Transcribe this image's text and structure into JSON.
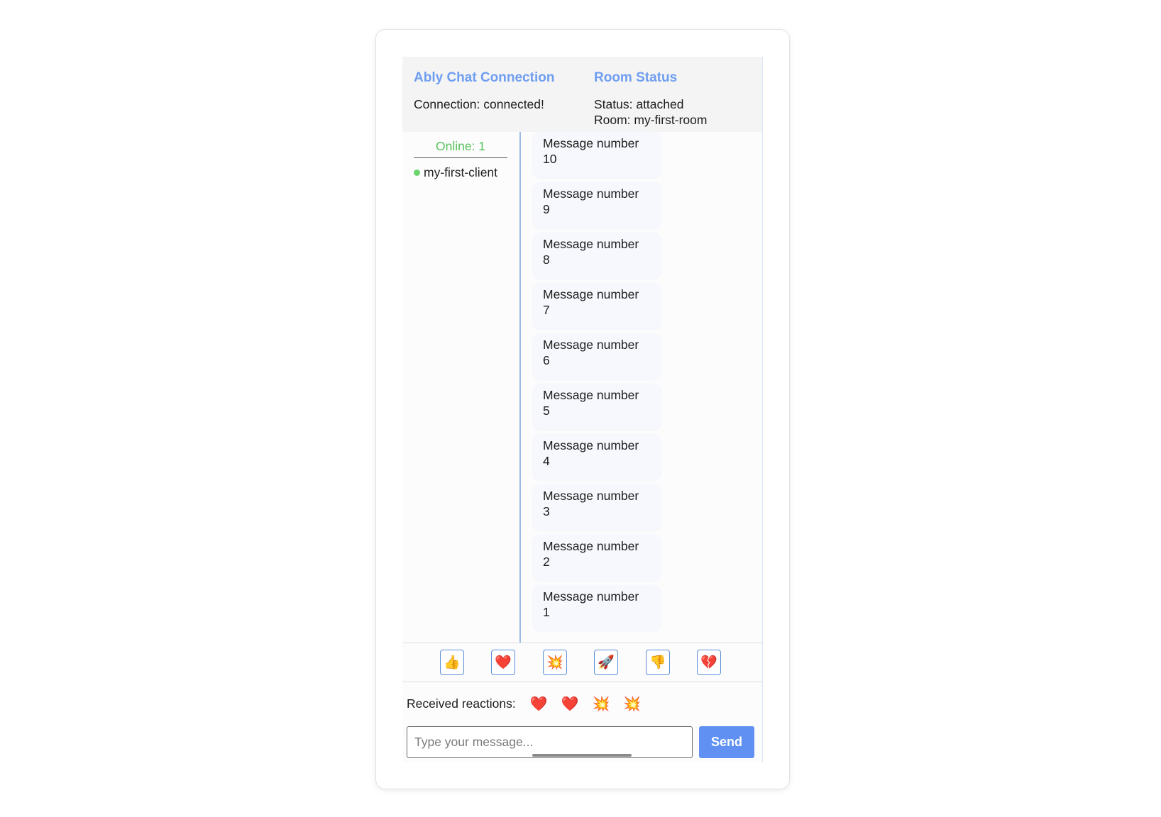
{
  "header": {
    "connection_title": "Ably Chat Connection",
    "connection_status": "Connection: connected!",
    "room_title": "Room Status",
    "room_status": "Status: attached",
    "room_name": "Room: my-first-room"
  },
  "presence": {
    "online_label": "Online: 1",
    "users": [
      "my-first-client"
    ]
  },
  "messages": [
    {
      "line1": "Message number",
      "line2": "10"
    },
    {
      "line1": "Message number",
      "line2": "9"
    },
    {
      "line1": "Message number",
      "line2": "8"
    },
    {
      "line1": "Message number",
      "line2": "7"
    },
    {
      "line1": "Message number",
      "line2": "6"
    },
    {
      "line1": "Message number",
      "line2": "5"
    },
    {
      "line1": "Message number",
      "line2": "4"
    },
    {
      "line1": "Message number",
      "line2": "3"
    },
    {
      "line1": "Message number",
      "line2": "2"
    },
    {
      "line1": "Message number",
      "line2": "1"
    }
  ],
  "reaction_buttons": [
    {
      "name": "thumbs-up-icon",
      "glyph": "👍"
    },
    {
      "name": "heart-icon",
      "glyph": "❤️"
    },
    {
      "name": "collision-icon",
      "glyph": "💥"
    },
    {
      "name": "rocket-icon",
      "glyph": "🚀"
    },
    {
      "name": "thumbs-down-icon",
      "glyph": "👎"
    },
    {
      "name": "broken-heart-icon",
      "glyph": "💔"
    }
  ],
  "received": {
    "label": "Received reactions:",
    "items": [
      {
        "name": "heart-icon",
        "glyph": "❤️"
      },
      {
        "name": "heart-icon",
        "glyph": "❤️"
      },
      {
        "name": "collision-icon",
        "glyph": "💥"
      },
      {
        "name": "collision-icon",
        "glyph": "💥"
      }
    ]
  },
  "composer": {
    "placeholder": "Type your message...",
    "value": "",
    "send_label": "Send"
  },
  "colors": {
    "accent": "#5f90f2",
    "title": "#6f9ef0",
    "online": "#58c35d"
  }
}
